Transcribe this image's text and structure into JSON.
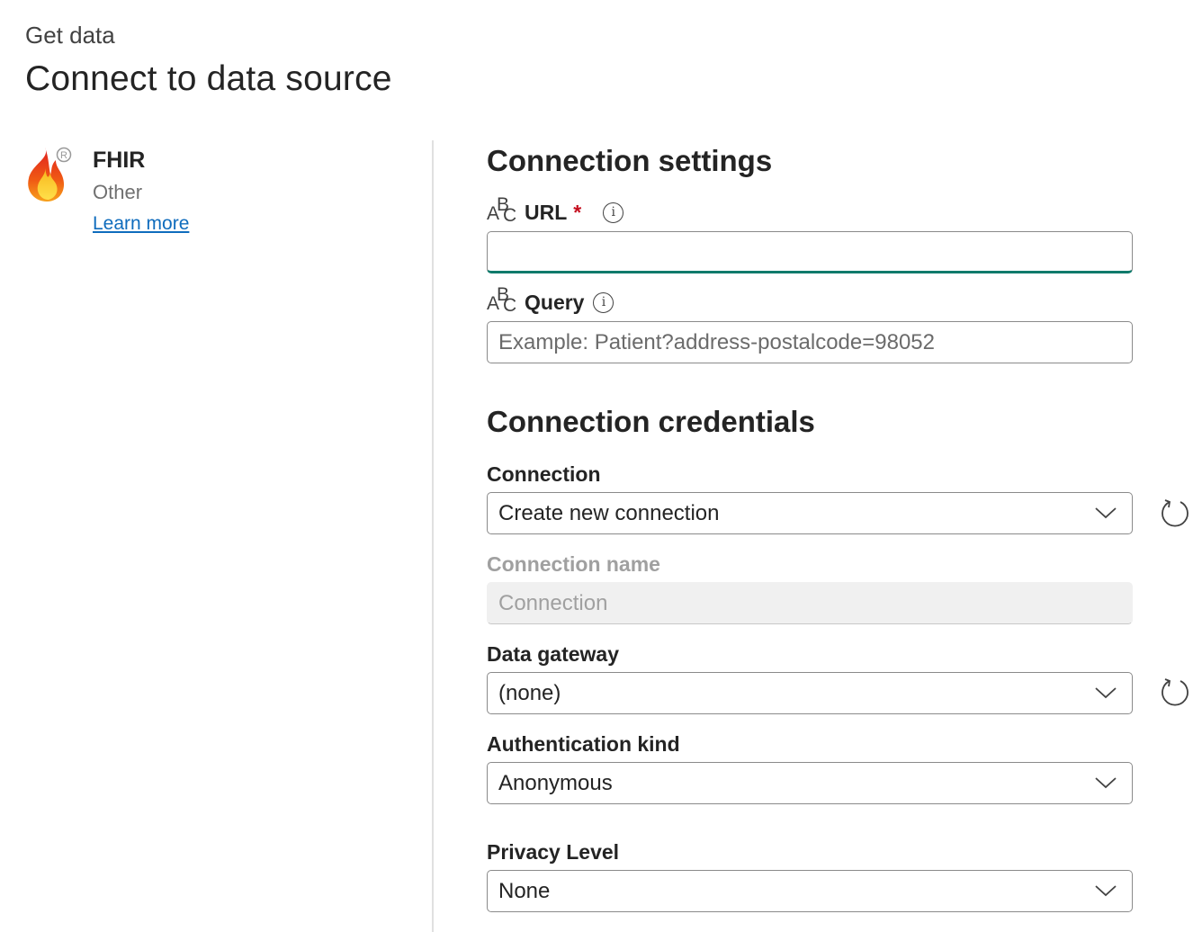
{
  "header": {
    "breadcrumb": "Get data",
    "title": "Connect to data source"
  },
  "connector": {
    "name": "FHIR",
    "category": "Other",
    "learn_more": "Learn more",
    "logo_icon": "fhir-flame-logo"
  },
  "connection_settings": {
    "title": "Connection settings",
    "url": {
      "label": "URL",
      "required_marker": "*",
      "value": ""
    },
    "query": {
      "label": "Query",
      "placeholder": "Example: Patient?address-postalcode=98052"
    }
  },
  "connection_credentials": {
    "title": "Connection credentials",
    "connection": {
      "label": "Connection",
      "value": "Create new connection"
    },
    "connection_name": {
      "label": "Connection name",
      "placeholder": "Connection"
    },
    "data_gateway": {
      "label": "Data gateway",
      "value": "(none)"
    },
    "authentication_kind": {
      "label": "Authentication kind",
      "value": "Anonymous"
    },
    "privacy_level": {
      "label": "Privacy Level",
      "value": "None"
    }
  },
  "colors": {
    "accent_focus": "#0f7a6b",
    "link": "#0f6cbd",
    "required": "#c50f1f"
  }
}
